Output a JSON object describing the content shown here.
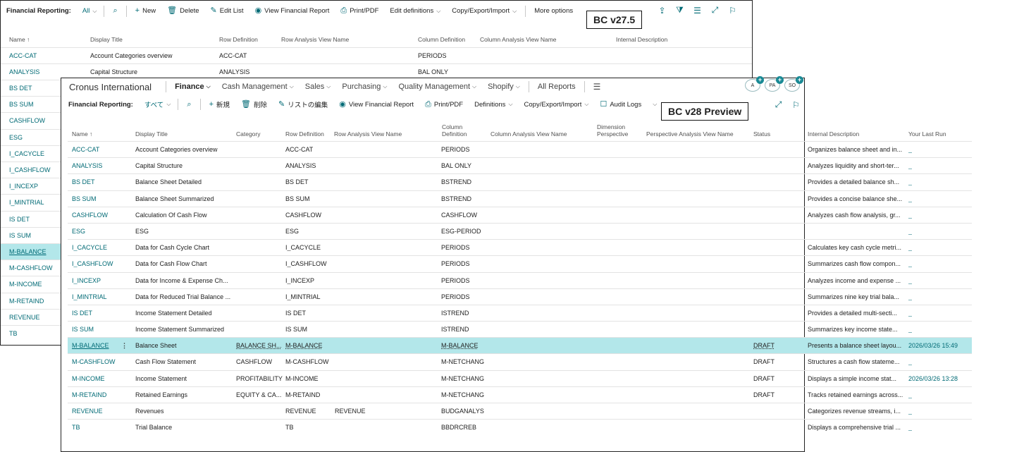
{
  "badges": {
    "old": "BC v27.5",
    "new": "BC v28 Preview"
  },
  "old_window": {
    "toolbar": {
      "title": "Financial Reporting:",
      "filter": "All",
      "new": "New",
      "delete": "Delete",
      "edit_list": "Edit List",
      "view_report": "View Financial Report",
      "print": "Print/PDF",
      "edit_definitions": "Edit definitions",
      "copy_export": "Copy/Export/Import",
      "more": "More options"
    },
    "columns": [
      "Name ↑",
      "Display Title",
      "Row Definition",
      "Row Analysis View Name",
      "Column Definition",
      "Column Analysis View Name",
      "Internal Description"
    ],
    "rows": [
      {
        "name": "ACC-CAT",
        "title": "Account Categories overview",
        "row_def": "ACC-CAT",
        "col_def": "PERIODS"
      },
      {
        "name": "ANALYSIS",
        "title": "Capital Structure",
        "row_def": "ANALYSIS",
        "col_def": "BAL ONLY"
      }
    ],
    "side_items": [
      "BS DET",
      "BS SUM",
      "CASHFLOW",
      "ESG",
      "I_CACYCLE",
      "I_CASHFLOW",
      "I_INCEXP",
      "I_MINTRIAL",
      "IS DET",
      "IS SUM",
      "M-BALANCE",
      "M-CASHFLOW",
      "M-INCOME",
      "M-RETAIND",
      "REVENUE",
      "TB"
    ]
  },
  "new_window": {
    "nav": {
      "company": "Cronus International",
      "items": [
        "Finance",
        "Cash Management",
        "Sales",
        "Purchasing",
        "Quality Management",
        "Shopify"
      ],
      "all_reports": "All Reports"
    },
    "avatars": [
      "A",
      "PA",
      "SO"
    ],
    "toolbar": {
      "title": "Financial Reporting:",
      "filter": "すべて",
      "new": "新規",
      "delete": "削除",
      "edit_list": "リストの編集",
      "view_report": "View Financial Report",
      "print": "Print/PDF",
      "definitions": "Definitions",
      "copy_export": "Copy/Export/Import",
      "audit_logs": "Audit Logs"
    },
    "columns": {
      "name": "Name ↑",
      "title": "Display Title",
      "category": "Category",
      "row_def": "Row Definition",
      "row_view": "Row Analysis View Name",
      "col_def_1": "Column",
      "col_def_2": "Definition",
      "col_view": "Column Analysis View Name",
      "dim_1": "Dimension",
      "dim_2": "Perspective",
      "persp_view": "Perspective Analysis View Name",
      "status": "Status",
      "internal": "Internal Description",
      "last_run": "Your Last Run"
    },
    "rows": [
      {
        "name": "ACC-CAT",
        "title": "Account Categories overview",
        "category": "",
        "row_def": "ACC-CAT",
        "row_view": "",
        "col_def": "PERIODS",
        "status": "",
        "internal": "Organizes balance sheet and in...",
        "last_run": "_"
      },
      {
        "name": "ANALYSIS",
        "title": "Capital Structure",
        "category": "",
        "row_def": "ANALYSIS",
        "row_view": "",
        "col_def": "BAL ONLY",
        "status": "",
        "internal": "Analyzes liquidity and short-ter...",
        "last_run": "_"
      },
      {
        "name": "BS DET",
        "title": "Balance Sheet Detailed",
        "category": "",
        "row_def": "BS DET",
        "row_view": "",
        "col_def": "BSTREND",
        "status": "",
        "internal": "Provides a detailed balance sh...",
        "last_run": "_"
      },
      {
        "name": "BS SUM",
        "title": "Balance Sheet Summarized",
        "category": "",
        "row_def": "BS SUM",
        "row_view": "",
        "col_def": "BSTREND",
        "status": "",
        "internal": "Provides a concise balance she...",
        "last_run": "_"
      },
      {
        "name": "CASHFLOW",
        "title": "Calculation Of Cash Flow",
        "category": "",
        "row_def": "CASHFLOW",
        "row_view": "",
        "col_def": "CASHFLOW",
        "status": "",
        "internal": "Analyzes cash flow analysis, gr...",
        "last_run": "_"
      },
      {
        "name": "ESG",
        "title": "ESG",
        "category": "",
        "row_def": "ESG",
        "row_view": "",
        "col_def": "ESG-PERIOD",
        "status": "",
        "internal": "",
        "last_run": "_"
      },
      {
        "name": "I_CACYCLE",
        "title": "Data for Cash Cycle Chart",
        "category": "",
        "row_def": "I_CACYCLE",
        "row_view": "",
        "col_def": "PERIODS",
        "status": "",
        "internal": "Calculates key cash cycle metri...",
        "last_run": "_"
      },
      {
        "name": "I_CASHFLOW",
        "title": "Data for Cash Flow Chart",
        "category": "",
        "row_def": "I_CASHFLOW",
        "row_view": "",
        "col_def": "PERIODS",
        "status": "",
        "internal": "Summarizes cash flow compon...",
        "last_run": "_"
      },
      {
        "name": "I_INCEXP",
        "title": "Data for Income & Expense Ch...",
        "category": "",
        "row_def": "I_INCEXP",
        "row_view": "",
        "col_def": "PERIODS",
        "status": "",
        "internal": "Analyzes income and expense ...",
        "last_run": "_"
      },
      {
        "name": "I_MINTRIAL",
        "title": "Data for Reduced Trial Balance ...",
        "category": "",
        "row_def": "I_MINTRIAL",
        "row_view": "",
        "col_def": "PERIODS",
        "status": "",
        "internal": "Summarizes nine key trial bala...",
        "last_run": "_"
      },
      {
        "name": "IS DET",
        "title": "Income Statement Detailed",
        "category": "",
        "row_def": "IS DET",
        "row_view": "",
        "col_def": "ISTREND",
        "status": "",
        "internal": "Provides a detailed multi-secti...",
        "last_run": "_"
      },
      {
        "name": "IS SUM",
        "title": "Income Statement Summarized",
        "category": "",
        "row_def": "IS SUM",
        "row_view": "",
        "col_def": "ISTREND",
        "status": "",
        "internal": "Summarizes key income state...",
        "last_run": "_"
      },
      {
        "name": "M-BALANCE",
        "title": "Balance Sheet",
        "category": "BALANCE SH...",
        "row_def": "M-BALANCE",
        "row_view": "",
        "col_def": "M-BALANCE",
        "status": "DRAFT",
        "internal": "Presents a balance sheet layou...",
        "last_run": "2026/03/26 15:49"
      },
      {
        "name": "M-CASHFLOW",
        "title": "Cash Flow Statement",
        "category": "CASHFLOW",
        "row_def": "M-CASHFLOW",
        "row_view": "",
        "col_def": "M-NETCHANG",
        "status": "DRAFT",
        "internal": "Structures a cash flow stateme...",
        "last_run": "_"
      },
      {
        "name": "M-INCOME",
        "title": "Income Statement",
        "category": "PROFITABILITY",
        "row_def": "M-INCOME",
        "row_view": "",
        "col_def": "M-NETCHANG",
        "status": "DRAFT",
        "internal": "Displays a simple income stat...",
        "last_run": "2026/03/26 13:28"
      },
      {
        "name": "M-RETAIND",
        "title": "Retained Earnings",
        "category": "EQUITY & CA...",
        "row_def": "M-RETAIND",
        "row_view": "",
        "col_def": "M-NETCHANG",
        "status": "DRAFT",
        "internal": "Tracks retained earnings across...",
        "last_run": "_"
      },
      {
        "name": "REVENUE",
        "title": "Revenues",
        "category": "",
        "row_def": "REVENUE",
        "row_view": "REVENUE",
        "col_def": "BUDGANALYS",
        "status": "",
        "internal": "Categorizes revenue streams, i...",
        "last_run": "_"
      },
      {
        "name": "TB",
        "title": "Trial Balance",
        "category": "",
        "row_def": "TB",
        "row_view": "",
        "col_def": "BBDRCREB",
        "status": "",
        "internal": "Displays a comprehensive trial ...",
        "last_run": "_"
      }
    ],
    "selected_index": 12
  }
}
